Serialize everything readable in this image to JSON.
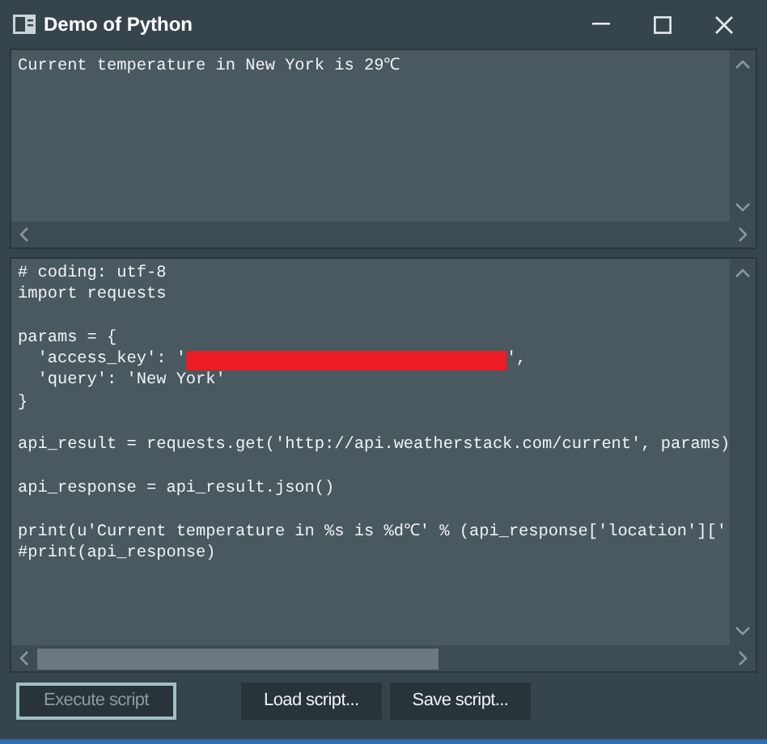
{
  "window": {
    "title": "Demo of Python"
  },
  "output": {
    "lines": [
      "Current temperature in New York is 29℃"
    ]
  },
  "editor": {
    "blocks": [
      [
        {
          "text": "# coding: utf-8"
        },
        {
          "text": "import requests"
        }
      ],
      [
        {
          "text": "params = {"
        },
        {
          "text": "  'access_key': '",
          "after": "',",
          "redacted": true
        },
        {
          "text": "  'query': 'New York'"
        },
        {
          "text": "}"
        }
      ],
      [
        {
          "text": "api_result = requests.get('http://api.weatherstack.com/current', params)"
        }
      ],
      [
        {
          "text": "api_response = api_result.json()"
        }
      ],
      [
        {
          "text": "print(u'Current temperature in %s is %d℃' % (api_response['location']['"
        },
        {
          "text": "#print(api_response)"
        }
      ]
    ]
  },
  "buttons": [
    {
      "label": "Execute script",
      "disabled": true,
      "focused": true
    },
    {
      "label": "Load script...",
      "disabled": false,
      "focused": false
    },
    {
      "label": "Save script...",
      "disabled": false,
      "focused": false
    }
  ]
}
